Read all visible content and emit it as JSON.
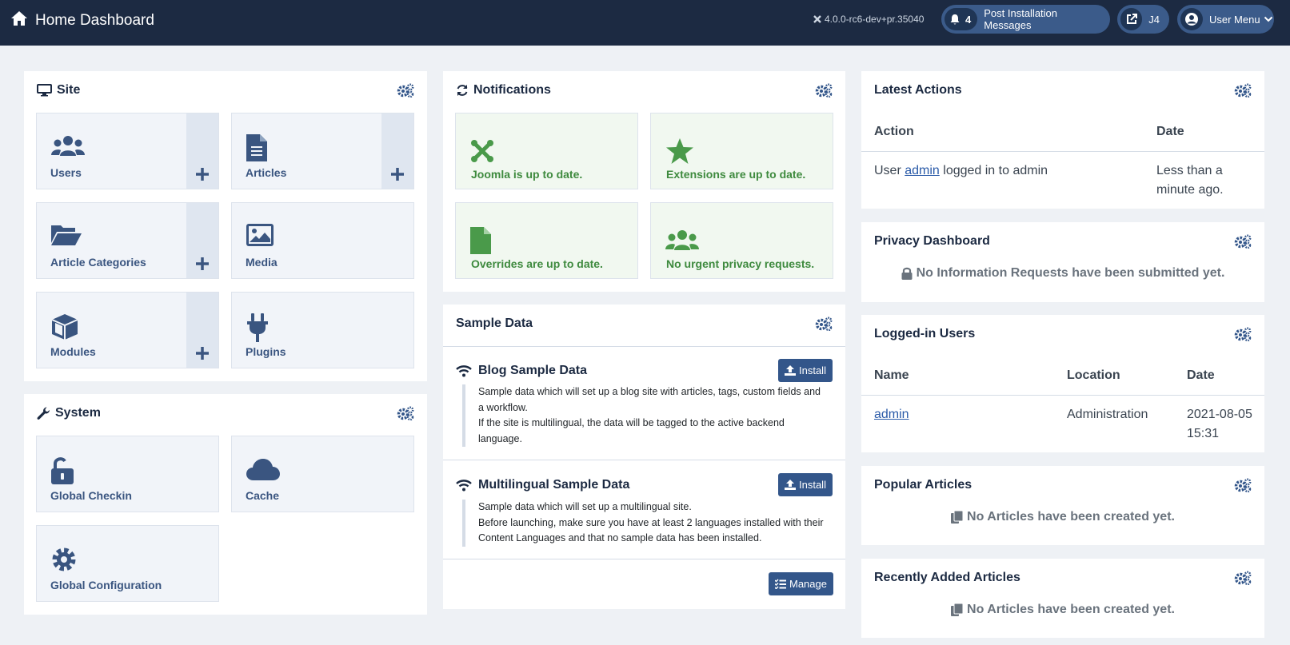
{
  "header": {
    "title": "Home Dashboard",
    "version": "4.0.0-rc6-dev+pr.35040",
    "notifications_count": "4",
    "post_install_label": "Post Installation Messages",
    "site_label": "J4",
    "user_menu_label": "User Menu"
  },
  "site": {
    "title": "Site",
    "tiles": [
      {
        "label": "Users"
      },
      {
        "label": "Articles"
      },
      {
        "label": "Article Categories"
      },
      {
        "label": "Media"
      },
      {
        "label": "Modules"
      },
      {
        "label": "Plugins"
      }
    ]
  },
  "system": {
    "title": "System",
    "tiles": [
      {
        "label": "Global Checkin"
      },
      {
        "label": "Cache"
      },
      {
        "label": "Global Configuration"
      }
    ]
  },
  "notifications": {
    "title": "Notifications",
    "items": [
      {
        "label": "Joomla is up to date."
      },
      {
        "label": "Extensions are up to date."
      },
      {
        "label": "Overrides are up to date."
      },
      {
        "label": "No urgent privacy requests."
      }
    ]
  },
  "sample_data": {
    "title": "Sample Data",
    "blog": {
      "title": "Blog Sample Data",
      "desc1": "Sample data which will set up a blog site with articles, tags, custom fields and a workflow.",
      "desc2": "If the site is multilingual, the data will be tagged to the active backend language.",
      "install_label": "Install"
    },
    "multilingual": {
      "title": "Multilingual Sample Data",
      "desc1": "Sample data which will set up a multilingual site.",
      "desc2": "Before launching, make sure you have at least 2 languages installed with their Content Languages and that no sample data has been installed.",
      "install_label": "Install"
    },
    "manage_label": "Manage"
  },
  "latest_actions": {
    "title": "Latest Actions",
    "col_action": "Action",
    "col_date": "Date",
    "row_prefix": "User ",
    "row_user": "admin",
    "row_suffix": " logged in to admin",
    "row_date": "Less than a minute ago."
  },
  "privacy": {
    "title": "Privacy Dashboard",
    "empty": "No Information Requests have been submitted yet."
  },
  "logged_in": {
    "title": "Logged-in Users",
    "col_name": "Name",
    "col_location": "Location",
    "col_date": "Date",
    "row_name": "admin",
    "row_location": "Administration",
    "row_date": "2021-08-05 15:31"
  },
  "popular": {
    "title": "Popular Articles",
    "empty": "No Articles have been created yet."
  },
  "recent": {
    "title": "Recently Added Articles",
    "empty": "No Articles have been created yet."
  },
  "colors": {
    "header_bg": "#1c2a42",
    "accent": "#33568a",
    "success": "#3e8a3e",
    "tile_bg": "#f1f4f9"
  }
}
